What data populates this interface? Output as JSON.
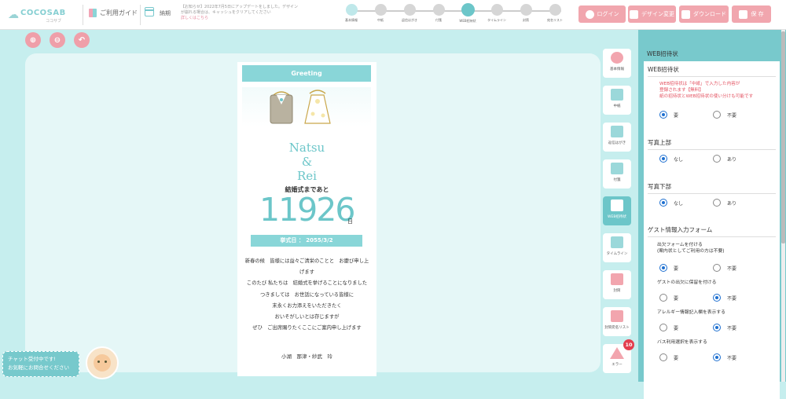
{
  "header": {
    "logo": "COCOSAB",
    "logo_sub": "ココサブ",
    "guide_label": "ご利用ガイド",
    "notice_label": "納期",
    "notice_text": "【お知らせ】2022年7月5日にアップデートをしました。デザインが崩れる場合は、キャッシュをクリアしてください",
    "notice_link": "詳しくはこちら",
    "steps": [
      "基本情報",
      "中紙",
      "返信はがき",
      "付箋",
      "WEB招待状",
      "タイムライン",
      "封筒",
      "宛名リスト"
    ],
    "current_step": 4,
    "buttons": {
      "login": "ログイン",
      "change_design": "デザイン変更",
      "download": "ダウンロード",
      "save": "保 存"
    }
  },
  "invitation": {
    "greeting": "Greeting",
    "name1": "Natsu",
    "amp": "&",
    "name2": "Rei",
    "until_label": "結婚式まであと",
    "days": "11926",
    "days_unit": "日",
    "date_label": "挙式日 ： 2055/3/2",
    "message": [
      "新春の候　皆様には益々ご清栄のことと　お慶び申し上げます",
      "このたび 私たちは　結婚式を挙げることになりました",
      "つきましては　お世話になっている皆様に",
      "末永くお力添えをいただきたく",
      "おいそがしいとは存じますが",
      "ぜひ　ご出席賜りたくここにご案内申し上げます"
    ],
    "signoff": "小湖　那津・紗武　玲"
  },
  "chat": {
    "line1": "チャット受付中です!",
    "line2": "お気軽にお問合せください"
  },
  "rail": {
    "items": [
      "基本情報",
      "中紙",
      "返信はがき",
      "付箋",
      "WEB招待状",
      "タイムライン",
      "封筒",
      "封筒宛名リスト",
      "エラー"
    ],
    "error_count": "10"
  },
  "panel": {
    "title": "WEB招待状",
    "sections": {
      "web_invitation": {
        "label": "WEB招待状",
        "notes": [
          "WEB招待状は「中紙」で入力した内容が",
          "登録されます【無料】",
          "紙の招待状とWEB招待状の使い分けも可能です"
        ],
        "options": [
          "要",
          "不要"
        ],
        "selected": "要"
      },
      "photo_top": {
        "label": "写真上部",
        "options": [
          "なし",
          "あり"
        ],
        "selected": "なし"
      },
      "photo_bottom": {
        "label": "写真下部",
        "options": [
          "なし",
          "あり"
        ],
        "selected": "なし"
      },
      "guest_form": {
        "label": "ゲスト情報入力フォーム",
        "attendance_label_1": "出欠フォームを付ける",
        "attendance_label_2": "(案内状としてご利用の方は不要)",
        "attendance_options": [
          "要",
          "不要"
        ],
        "attendance_selected": "要",
        "hold_label": "ゲストの出欠に保留を付ける",
        "hold_options": [
          "要",
          "不要"
        ],
        "hold_selected": "不要",
        "allergy_label": "アレルギー情報記入欄を表示する",
        "allergy_options": [
          "要",
          "不要"
        ],
        "allergy_selected": "不要",
        "bus_label": "バス利用選択を表示する",
        "bus_options": [
          "要",
          "不要"
        ],
        "bus_selected": "不要"
      }
    }
  },
  "colors": {
    "accent": "#6cc6c9",
    "pink": "#f1a6ae",
    "error": "#e33e4e",
    "radio": "#1d6fd0"
  }
}
